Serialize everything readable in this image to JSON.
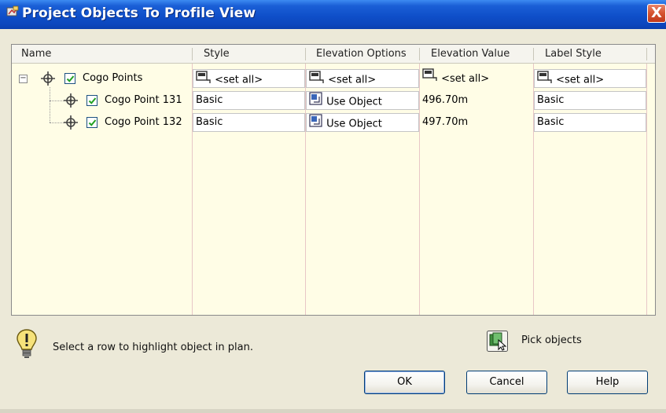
{
  "window": {
    "title": "Project Objects To Profile View",
    "close_glyph": "X"
  },
  "grid": {
    "columns": [
      "Name",
      "Style",
      "Elevation Options",
      "Elevation Value",
      "Label Style"
    ],
    "rows": [
      {
        "name": "Cogo Points",
        "style": "<set all>",
        "elevation_option": "<set all>",
        "elevation_value": "<set all>",
        "label_style": "<set all>",
        "checked": true,
        "expanded": true,
        "level": 0
      },
      {
        "name": "Cogo Point 131",
        "style": "Basic",
        "elevation_option": "Use Object",
        "elevation_value": "496.70m",
        "label_style": "Basic",
        "checked": true,
        "level": 1
      },
      {
        "name": "Cogo Point 132",
        "style": "Basic",
        "elevation_option": "Use Object",
        "elevation_value": "497.70m",
        "label_style": "Basic",
        "checked": true,
        "level": 1
      }
    ]
  },
  "footer": {
    "hint": "Select a row to highlight object in plan.",
    "pick_label": "Pick objects",
    "buttons": {
      "ok": "OK",
      "cancel": "Cancel",
      "help": "Help"
    }
  },
  "icons": {
    "title": "app-icon",
    "hint": "lightbulb-icon",
    "pick": "pick-objects-icon",
    "point": "cogo-point-icon",
    "set_all": "set-all-icon",
    "use_object": "use-object-icon"
  },
  "colors": {
    "titlebar": "#0b46bd",
    "grid_background": "#fffde6",
    "close_button": "#d5532f"
  }
}
